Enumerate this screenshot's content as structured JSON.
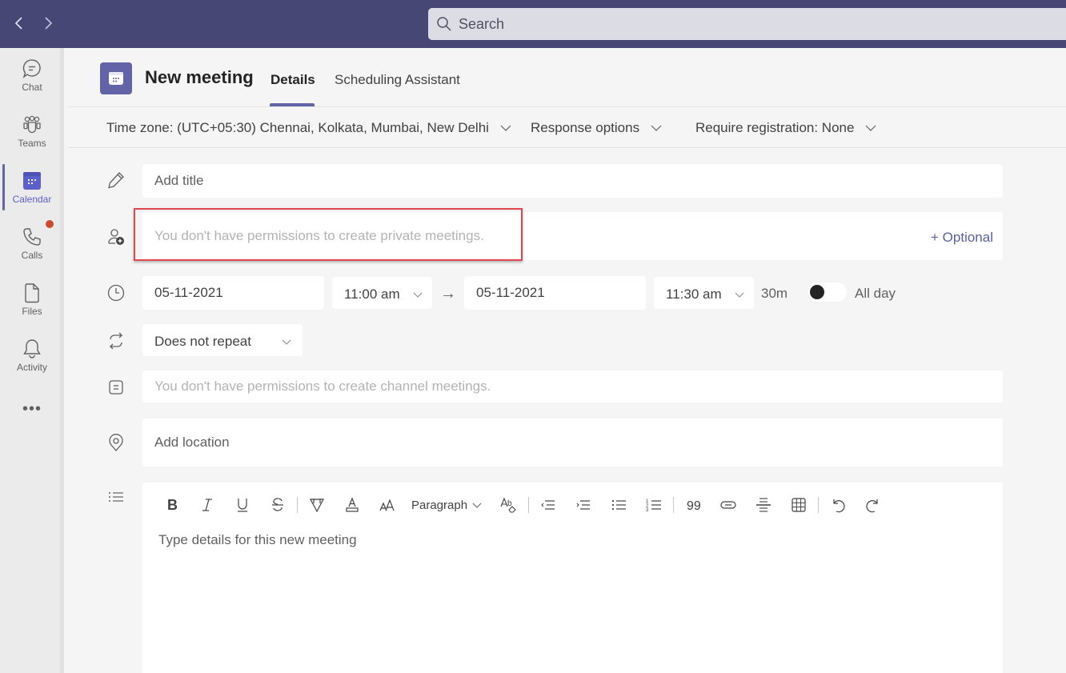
{
  "topbar": {
    "back_icon": "chevron-left-icon",
    "forward_icon": "chevron-right-icon",
    "search": {
      "placeholder": "Search",
      "value": ""
    }
  },
  "rail": {
    "items": [
      {
        "label": "Chat",
        "icon": "chat-icon",
        "active": false
      },
      {
        "label": "Teams",
        "icon": "teams-icon",
        "active": false
      },
      {
        "label": "Calendar",
        "icon": "calendar-icon",
        "active": true
      },
      {
        "label": "Calls",
        "icon": "phone-icon",
        "active": false,
        "badge": true
      },
      {
        "label": "Files",
        "icon": "file-icon",
        "active": false
      },
      {
        "label": "Activity",
        "icon": "bell-icon",
        "active": false
      }
    ],
    "more_label": "•••"
  },
  "header": {
    "title": "New meeting",
    "tabs": [
      {
        "label": "Details",
        "active": true
      },
      {
        "label": "Scheduling Assistant",
        "active": false
      }
    ]
  },
  "options": {
    "timezone": "Time zone: (UTC+05:30) Chennai, Kolkata, Mumbai, New Delhi",
    "response": "Response options",
    "registration": "Require registration: None"
  },
  "form": {
    "title_placeholder": "Add title",
    "attendees_message": "You don't have permissions to create private meetings.",
    "optional_link": "+ Optional",
    "start_date": "05-11-2021",
    "start_time": "11:00 am",
    "end_date": "05-11-2021",
    "end_time": "11:30 am",
    "duration": "30m",
    "allday_label": "All day",
    "allday_on": false,
    "repeat": "Does not repeat",
    "channel_message": "You don't have permissions to create channel meetings.",
    "location_placeholder": "Add location",
    "details_placeholder": "Type details for this new meeting"
  },
  "editor_toolbar": {
    "paragraph_label": "Paragraph",
    "buttons": [
      "bold",
      "italic",
      "underline",
      "strikethrough",
      "highlight",
      "font-color",
      "font-size",
      "paragraph",
      "clear-formatting",
      "decrease-indent",
      "increase-indent",
      "bulleted-list",
      "numbered-list",
      "quote",
      "link",
      "horizontal-rule",
      "table",
      "undo",
      "redo"
    ]
  }
}
